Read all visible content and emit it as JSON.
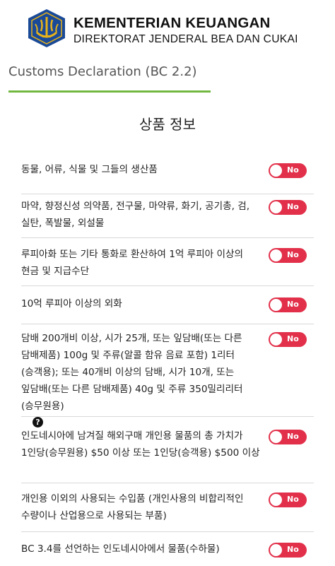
{
  "header": {
    "ministry": "KEMENTERIAN KEUANGAN",
    "directorate": "DIREKTORAT JENDERAL BEA DAN CUKAI"
  },
  "tab": {
    "title": "Customs Declaration (BC 2.2)"
  },
  "section": {
    "title": "상품 정보"
  },
  "colors": {
    "accent_green": "#72b840",
    "toggle_red": "#e2304a",
    "logo_blue": "#1a4a97",
    "logo_gold": "#e8b21a"
  },
  "items": [
    {
      "text": "동물, 어류, 식물 및 그들의 생산품",
      "toggle_label": "No"
    },
    {
      "text": "마약, 향정신성 의약품, 전구물, 마약류, 화기, 공기총, 검, 실탄, 폭발물, 외설물",
      "toggle_label": "No"
    },
    {
      "text": "루피아화 또는 기타 통화로 환산하여 1억 루피아 이상의 현금 및 지급수단",
      "toggle_label": "No"
    },
    {
      "text": "10억 루피아 이상의 외화",
      "toggle_label": "No"
    },
    {
      "text": "담배 200개비 이상, 시가 25개, 또는 잎담배(또는 다른 담배제품) 100g 및 주류(알콜 함유 음료 포함) 1리터 (승객용); 또는 40개비 이상의 담배, 시가 10개, 또는 잎담배(또는 다른 담배제품) 40g 및 주류 350밀리리터 (승무원용)",
      "toggle_label": "No",
      "help_icon": "question-circle"
    },
    {
      "text": "인도네시아에 남겨질 해외구매 개인용 물품의 총 가치가 1인당(승무원용) $50 이상 또는 1인당(승객용) $500 이상",
      "toggle_label": "No"
    },
    {
      "text": "개인용 이외의 사용되는 수입품 (개인사용의 비합리적인 수량이나 산업용으로 사용되는 부품)",
      "toggle_label": "No"
    },
    {
      "text": "BC 3.4를 선언하는 인도네시아에서 물품(수하물)",
      "toggle_label": "No"
    }
  ]
}
